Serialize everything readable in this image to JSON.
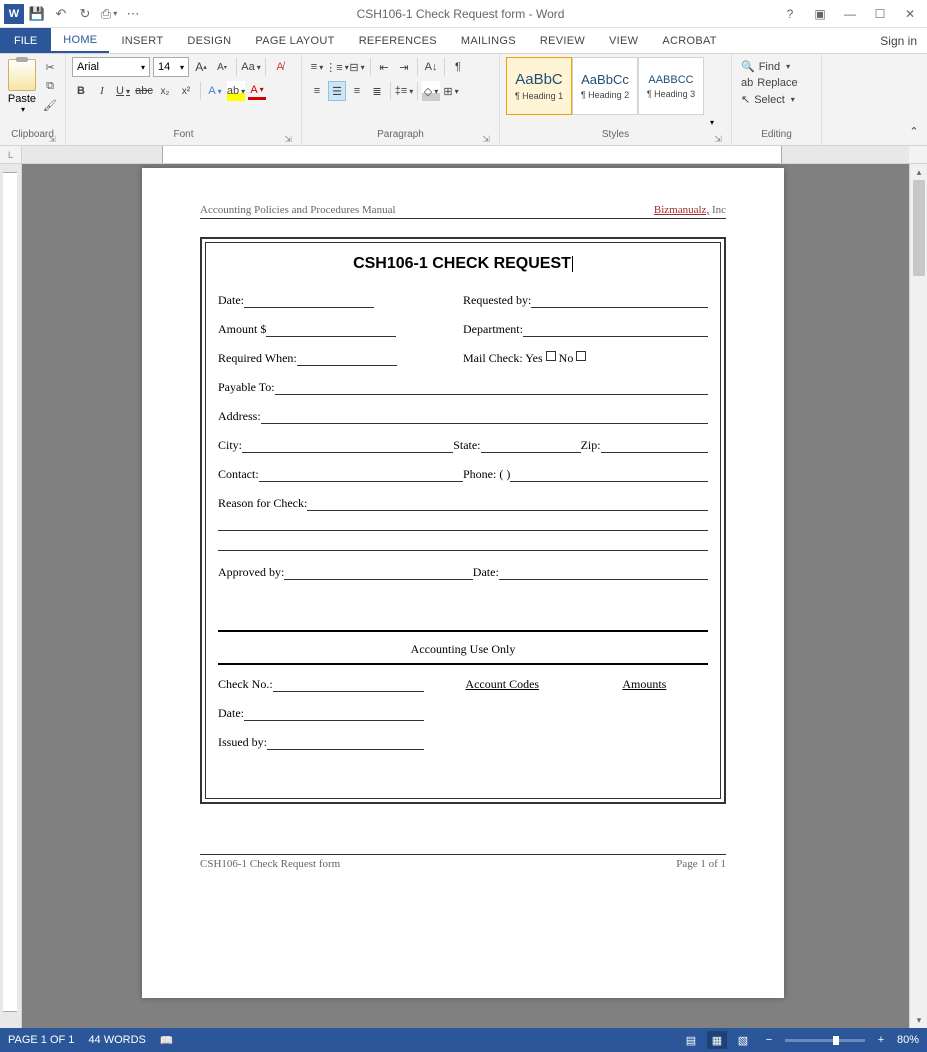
{
  "titlebar": {
    "title": "CSH106-1 Check Request form - Word",
    "signin": "Sign in"
  },
  "tabs": {
    "file": "FILE",
    "home": "HOME",
    "insert": "INSERT",
    "design": "DESIGN",
    "pagelayout": "PAGE LAYOUT",
    "references": "REFERENCES",
    "mailings": "MAILINGS",
    "review": "REVIEW",
    "view": "VIEW",
    "acrobat": "ACROBAT"
  },
  "ribbon": {
    "clipboard": {
      "paste": "Paste",
      "label": "Clipboard"
    },
    "font": {
      "name": "Arial",
      "size": "14",
      "label": "Font"
    },
    "paragraph": {
      "label": "Paragraph"
    },
    "styles": {
      "label": "Styles",
      "item1_preview": "AaBbC",
      "item1_name": "¶ Heading 1",
      "item2_preview": "AaBbCc",
      "item2_name": "¶ Heading 2",
      "item3_preview": "AABBCC",
      "item3_name": "¶ Heading 3"
    },
    "editing": {
      "find": "Find",
      "replace": "Replace",
      "select": "Select",
      "label": "Editing"
    }
  },
  "doc": {
    "header_left": "Accounting Policies and Procedures Manual",
    "header_link": "Bizmanualz,",
    "header_inc": " Inc",
    "title": "CSH106-1 CHECK REQUEST",
    "date": "Date:",
    "requested_by": "Requested by:",
    "amount": "Amount $",
    "department": "Department:",
    "required_when": "Required When:",
    "mail_check": "Mail Check:  Yes ",
    "no": "    No ",
    "payable_to": "Payable To:",
    "address": "Address:",
    "city": "City:",
    "state": "State:",
    "zip": "Zip:",
    "contact": "Contact:",
    "phone": "Phone: (               )",
    "reason": "Reason for Check:",
    "approved_by": "Approved by:",
    "approved_date": "Date:",
    "acct_only": "Accounting Use Only",
    "check_no": "Check No.:",
    "account_codes": "Account Codes",
    "amounts": "Amounts",
    "date2": "Date:",
    "issued_by": "Issued by:",
    "footer_left": "CSH106-1 Check Request form",
    "footer_right": "Page 1 of 1"
  },
  "status": {
    "page": "PAGE 1 OF 1",
    "words": "44 WORDS",
    "zoom": "80%"
  }
}
